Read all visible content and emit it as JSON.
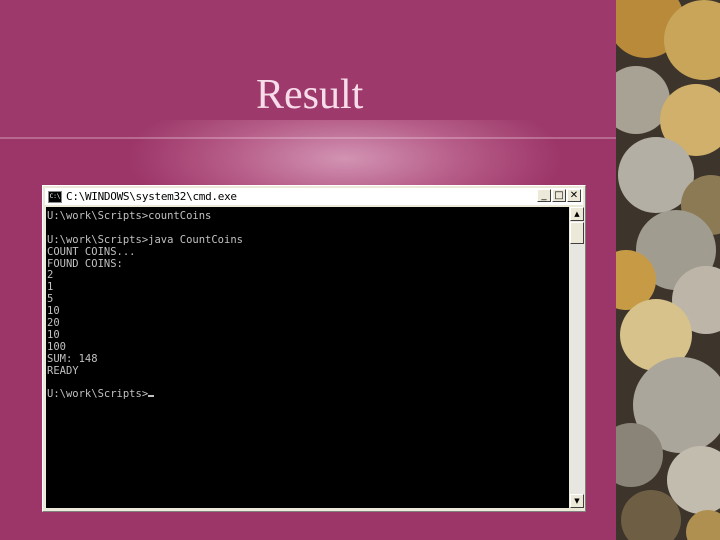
{
  "slide": {
    "title": "Result"
  },
  "window": {
    "title": "C:\\WINDOWS\\system32\\cmd.exe",
    "icon_label": "C:\\",
    "buttons": {
      "minimize": "_",
      "maximize": "□",
      "close": "✕"
    }
  },
  "console": {
    "lines": [
      "U:\\work\\Scripts>countCoins",
      "",
      "U:\\work\\Scripts>java CountCoins",
      "COUNT COINS...",
      "FOUND COINS:",
      "2",
      "1",
      "5",
      "10",
      "20",
      "10",
      "100",
      "SUM: 148",
      "READY",
      "",
      "U:\\work\\Scripts>"
    ]
  },
  "scrollbar": {
    "up": "▲",
    "down": "▼"
  },
  "colors": {
    "slide_background": "#9c3568",
    "title_text": "#f7dcea",
    "console_background": "#000000",
    "console_text": "#c0c0c0"
  }
}
